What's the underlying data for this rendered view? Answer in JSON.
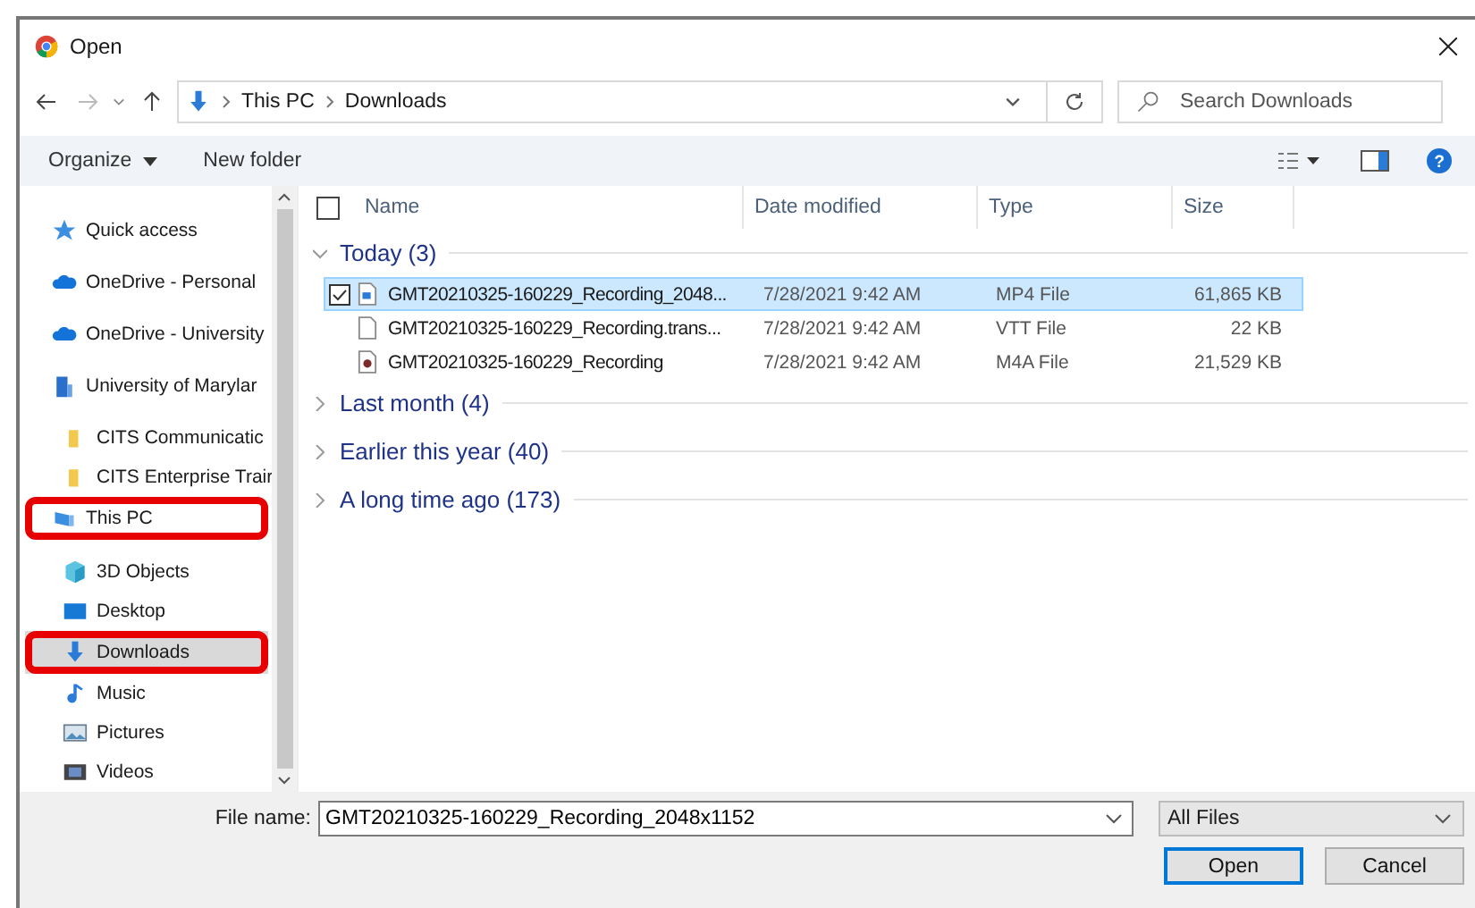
{
  "window": {
    "title": "Open"
  },
  "address": {
    "path": [
      "This PC",
      "Downloads"
    ]
  },
  "search": {
    "placeholder": "Search Downloads"
  },
  "toolbar": {
    "organize": "Organize",
    "new_folder": "New folder"
  },
  "sidebar": {
    "items": [
      {
        "label": "Quick access",
        "kind": "star",
        "selected": false,
        "circled": false
      },
      {
        "label": "OneDrive - Personal",
        "kind": "cloud",
        "selected": false,
        "circled": false
      },
      {
        "label": "OneDrive - University",
        "kind": "cloud",
        "selected": false,
        "circled": false
      },
      {
        "label": "University of Marylar",
        "kind": "building",
        "selected": false,
        "circled": false,
        "children": [
          {
            "label": "CITS Communicatic",
            "kind": "folder",
            "selected": false,
            "circled": false
          },
          {
            "label": "CITS Enterprise Trair",
            "kind": "folder",
            "selected": false,
            "circled": false
          }
        ]
      },
      {
        "label": "This PC",
        "kind": "pc",
        "selected": false,
        "circled": true,
        "children": [
          {
            "label": "3D Objects",
            "kind": "cube",
            "selected": false,
            "circled": false
          },
          {
            "label": "Desktop",
            "kind": "desktop",
            "selected": false,
            "circled": false
          },
          {
            "label": "Downloads",
            "kind": "download",
            "selected": true,
            "circled": true
          },
          {
            "label": "Music",
            "kind": "music",
            "selected": false,
            "circled": false
          },
          {
            "label": "Pictures",
            "kind": "picture",
            "selected": false,
            "circled": false
          },
          {
            "label": "Videos",
            "kind": "video",
            "selected": false,
            "circled": false
          }
        ]
      }
    ]
  },
  "help": {
    "symbol": "?"
  },
  "table": {
    "select_all_checked": false,
    "columns": [
      "Name",
      "Date modified",
      "Type",
      "Size"
    ],
    "groups": [
      {
        "label": "Today (3)",
        "expanded": true,
        "rows": [
          {
            "name": "GMT20210325-160229_Recording_2048...",
            "date": "7/28/2021 9:42 AM",
            "type": "MP4 File",
            "size": "61,865 KB",
            "kind": "video",
            "selected": true
          },
          {
            "name": "GMT20210325-160229_Recording.trans...",
            "date": "7/28/2021 9:42 AM",
            "type": "VTT File",
            "size": "22 KB",
            "kind": "text",
            "selected": false
          },
          {
            "name": "GMT20210325-160229_Recording",
            "date": "7/28/2021 9:42 AM",
            "type": "M4A File",
            "size": "21,529 KB",
            "kind": "audio",
            "selected": false
          }
        ]
      },
      {
        "label": "Last month (4)",
        "expanded": false
      },
      {
        "label": "Earlier this year (40)",
        "expanded": false
      },
      {
        "label": "A long time ago (173)",
        "expanded": false
      }
    ]
  },
  "footer": {
    "file_name_label": "File name:",
    "file_name": "GMT20210325-160229_Recording_2048x1152",
    "filter": "All Files",
    "buttons": [
      "Open",
      "Cancel"
    ]
  }
}
